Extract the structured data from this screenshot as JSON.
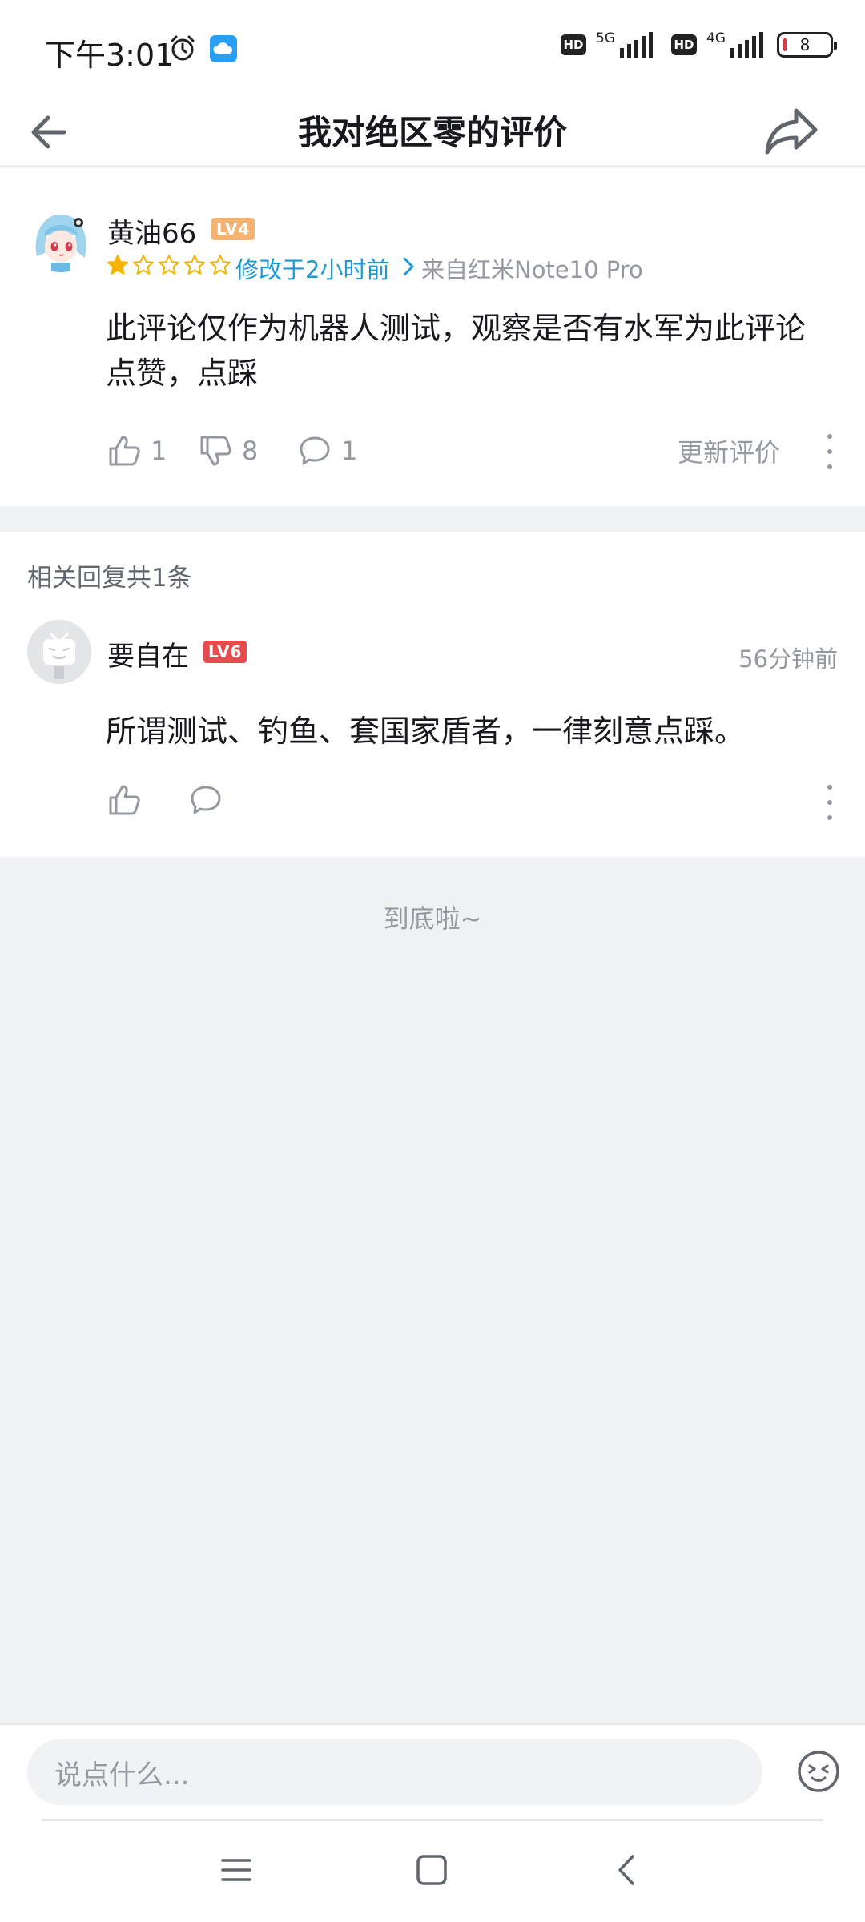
{
  "status_bar": {
    "time": "下午3:01",
    "hd_badge": "HD",
    "net1": "5G",
    "net2": "4G",
    "battery": "8"
  },
  "nav": {
    "title": "我对绝区零的评价",
    "back_icon": "arrow-left-icon",
    "share_icon": "share-icon"
  },
  "review": {
    "username": "黄油66",
    "level": "LV4",
    "level_color": "#f4b273",
    "rating": 1,
    "rating_max": 5,
    "modified": "修改于2小时前",
    "device": "来自红米Note10 Pro",
    "text": "此评论仅作为机器人测试，观察是否有水军为此评论点赞，点踩",
    "likes": "1",
    "dislikes": "8",
    "comments": "1",
    "update_label": "更新评价"
  },
  "replies": {
    "count_label": "相关回复共1条",
    "items": [
      {
        "username": "要自在",
        "level": "LV6",
        "level_color": "#e84b4b",
        "time": "56分钟前",
        "text": "所谓测试、钓鱼、套国家盾者，一律刻意点踩。"
      }
    ]
  },
  "end_label": "到底啦~",
  "comment_box": {
    "placeholder": "说点什么..."
  },
  "colors": {
    "accent": "#1a9ad7",
    "star": "#f7b500",
    "muted": "#9499a0"
  }
}
